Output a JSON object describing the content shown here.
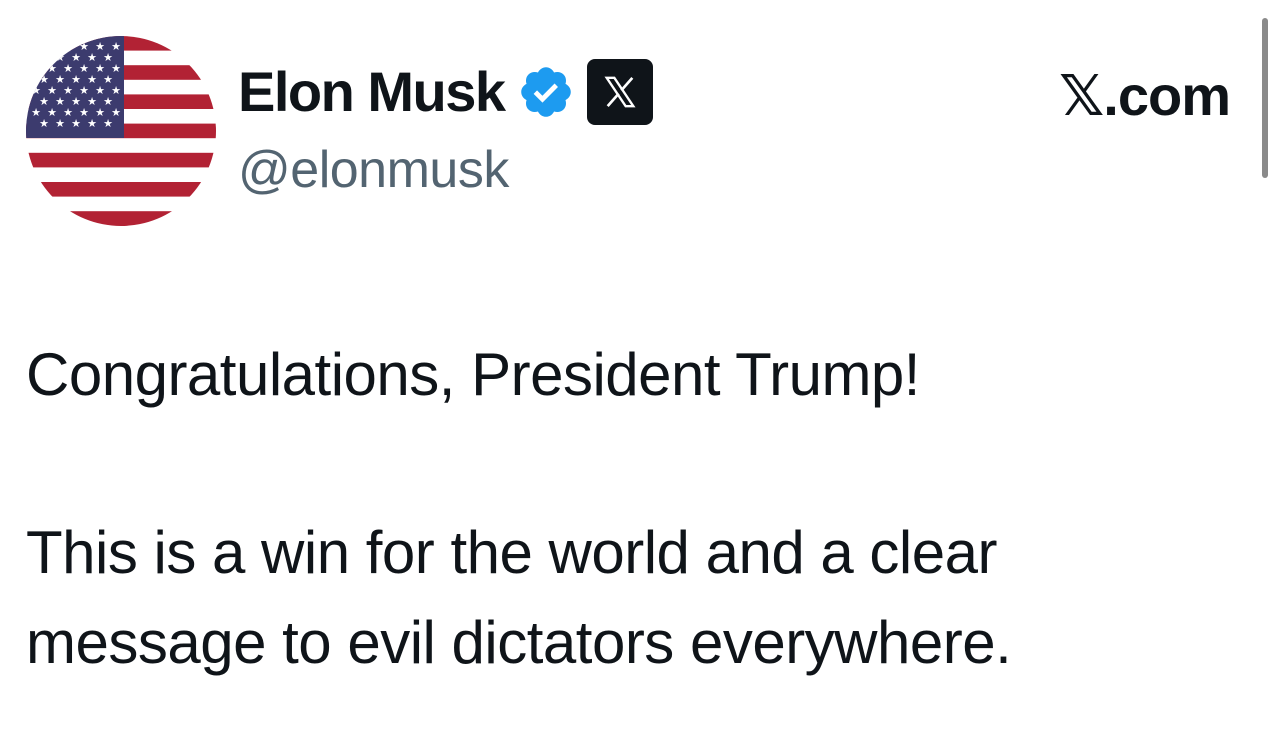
{
  "author": {
    "display_name": "Elon Musk",
    "handle": "@elonmusk",
    "verified_icon": "verified-badge-icon",
    "affiliation_icon": "x-logo-icon",
    "avatar": "us-flag-avatar"
  },
  "site": {
    "label": "𝕏.com"
  },
  "tweet": {
    "line1": "Congratulations, President Trump!",
    "line2": "This is a win for the world and a clear",
    "line3": "message to evil dictators everywhere."
  },
  "colors": {
    "text": "#0f1419",
    "secondary_text": "#536471",
    "verified_blue": "#1d9bf0",
    "flag_red": "#b22234",
    "flag_blue": "#3c3b6e"
  }
}
